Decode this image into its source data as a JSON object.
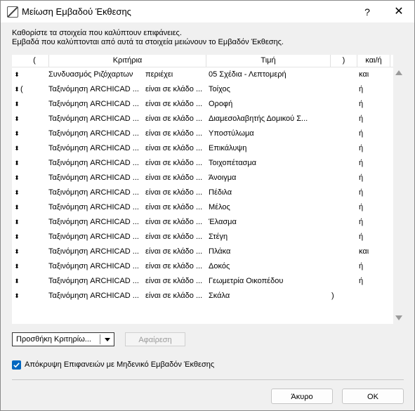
{
  "window": {
    "title": "Μείωση Εμβαδού Έκθεσης",
    "help": "?",
    "close": "✕"
  },
  "description": {
    "line1": "Καθορίστε τα στοιχεία που καλύπτουν επιφάνειες.",
    "line2": "Εμβαδά που καλύπτονται από αυτά τα στοιχεία μειώνουν το Εμβαδόν Έκθεσης."
  },
  "table": {
    "headers": {
      "lparen": "(",
      "criteria": "Κριτήρια",
      "value": "Τιμή",
      "rparen": ")",
      "andor": "και/ή"
    },
    "rows": [
      {
        "lp": "",
        "crit": "Συνδυασμός Ριζόχαρτων",
        "op": "περιέχει",
        "val": "05 Σχέδια - Λεπτομερή",
        "rp": "",
        "andor": "και"
      },
      {
        "lp": "(",
        "crit": "Ταξινόμηση ARCHICAD ...",
        "op": "είναι σε κλάδο ...",
        "val": "Τοίχος",
        "rp": "",
        "andor": "ή"
      },
      {
        "lp": "",
        "crit": "Ταξινόμηση ARCHICAD ...",
        "op": "είναι σε κλάδο ...",
        "val": "Οροφή",
        "rp": "",
        "andor": "ή"
      },
      {
        "lp": "",
        "crit": "Ταξινόμηση ARCHICAD ...",
        "op": "είναι σε κλάδο ...",
        "val": "Διαμεσολαβητής Δομικού Σ...",
        "rp": "",
        "andor": "ή"
      },
      {
        "lp": "",
        "crit": "Ταξινόμηση ARCHICAD ...",
        "op": "είναι σε κλάδο ...",
        "val": "Υποστύλωμα",
        "rp": "",
        "andor": "ή"
      },
      {
        "lp": "",
        "crit": "Ταξινόμηση ARCHICAD ...",
        "op": "είναι σε κλάδο ...",
        "val": "Επικάλυψη",
        "rp": "",
        "andor": "ή"
      },
      {
        "lp": "",
        "crit": "Ταξινόμηση ARCHICAD ...",
        "op": "είναι σε κλάδο ...",
        "val": "Τοιχοπέτασμα",
        "rp": "",
        "andor": "ή"
      },
      {
        "lp": "",
        "crit": "Ταξινόμηση ARCHICAD ...",
        "op": "είναι σε κλάδο ...",
        "val": "Άνοιγμα",
        "rp": "",
        "andor": "ή"
      },
      {
        "lp": "",
        "crit": "Ταξινόμηση ARCHICAD ...",
        "op": "είναι σε κλάδο ...",
        "val": "Πέδιλα",
        "rp": "",
        "andor": "ή"
      },
      {
        "lp": "",
        "crit": "Ταξινόμηση ARCHICAD ...",
        "op": "είναι σε κλάδο ...",
        "val": "Μέλος",
        "rp": "",
        "andor": "ή"
      },
      {
        "lp": "",
        "crit": "Ταξινόμηση ARCHICAD ...",
        "op": "είναι σε κλάδο ...",
        "val": "Έλασμα",
        "rp": "",
        "andor": "ή"
      },
      {
        "lp": "",
        "crit": "Ταξινόμηση ARCHICAD ...",
        "op": "είναι σε κλάδο ...",
        "val": "Στέγη",
        "rp": "",
        "andor": "ή"
      },
      {
        "lp": "",
        "crit": "Ταξινόμηση ARCHICAD ...",
        "op": "είναι σε κλάδο ...",
        "val": "Πλάκα",
        "rp": "",
        "andor": "και"
      },
      {
        "lp": "",
        "crit": "Ταξινόμηση ARCHICAD ...",
        "op": "είναι σε κλάδο ...",
        "val": "Δοκός",
        "rp": "",
        "andor": "ή"
      },
      {
        "lp": "",
        "crit": "Ταξινόμηση ARCHICAD ...",
        "op": "είναι σε κλάδο ...",
        "val": "Γεωμετρία Οικοπέδου",
        "rp": "",
        "andor": "ή"
      },
      {
        "lp": "",
        "crit": "Ταξινόμηση ARCHICAD ...",
        "op": "είναι σε κλάδο ...",
        "val": "Σκάλα",
        "rp": ")",
        "andor": ""
      }
    ]
  },
  "buttons": {
    "add": "Προσθήκη Κριτηρίω...",
    "remove": "Αφαίρεση",
    "cancel": "Άκυρο",
    "ok": "OK"
  },
  "checkbox": {
    "label": "Απόκρυψη Επιφανειών με Μηδενικό Εμβαδόν Έκθεσης",
    "checked": true
  },
  "colors": {
    "accent": "#0067c0"
  },
  "icons": {
    "drag": "drag-handle-icon",
    "app": "archicad-icon",
    "help": "help-icon",
    "close": "close-icon",
    "dropdown": "chevron-down-icon",
    "check": "checkmark-icon"
  }
}
